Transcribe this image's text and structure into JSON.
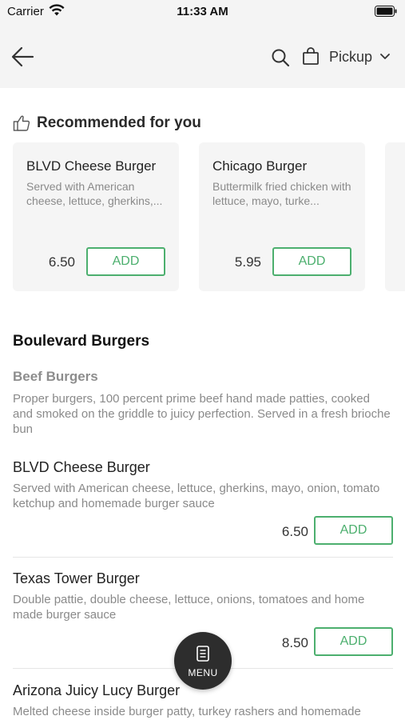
{
  "status_bar": {
    "carrier": "Carrier",
    "time": "11:33 AM"
  },
  "nav": {
    "pickup_label": "Pickup",
    "icons": [
      "back-arrow-icon",
      "search-icon",
      "shopping-bag-icon",
      "chevron-down-icon"
    ]
  },
  "recommended": {
    "title": "Recommended for you",
    "items": [
      {
        "name": "BLVD Cheese Burger",
        "description": "Served with American cheese, lettuce, gherkins,...",
        "price": "6.50",
        "add_label": "ADD"
      },
      {
        "name": "Chicago Burger",
        "description": "Buttermilk fried chicken with lettuce, mayo, turke...",
        "price": "5.95",
        "add_label": "ADD"
      }
    ]
  },
  "section": {
    "title": "Boulevard Burgers",
    "subsection_title": "Beef Burgers",
    "subsection_description": "Proper burgers, 100 percent prime beef hand made patties, cooked and smoked on the griddle to juicy perfection. Served in a fresh brioche bun"
  },
  "menu_items": [
    {
      "name": "BLVD Cheese Burger",
      "description": "Served with American cheese, lettuce, gherkins, mayo, onion, tomato ketchup and homemade burger sauce",
      "price": "6.50",
      "add_label": "ADD"
    },
    {
      "name": "Texas Tower Burger",
      "description": "Double pattie, double cheese, lettuce, onions, tomatoes and home made burger sauce",
      "price": "8.50",
      "add_label": "ADD"
    },
    {
      "name": "Arizona Juicy Lucy Burger",
      "description": "Melted cheese inside burger patty, turkey rashers and homemade"
    }
  ],
  "fab": {
    "label": "MENU"
  },
  "colors": {
    "accent": "#4caf6e",
    "header_bg": "#f4f4f4",
    "card_bg": "#f5f5f5",
    "fab_bg": "#2d2d2d"
  }
}
